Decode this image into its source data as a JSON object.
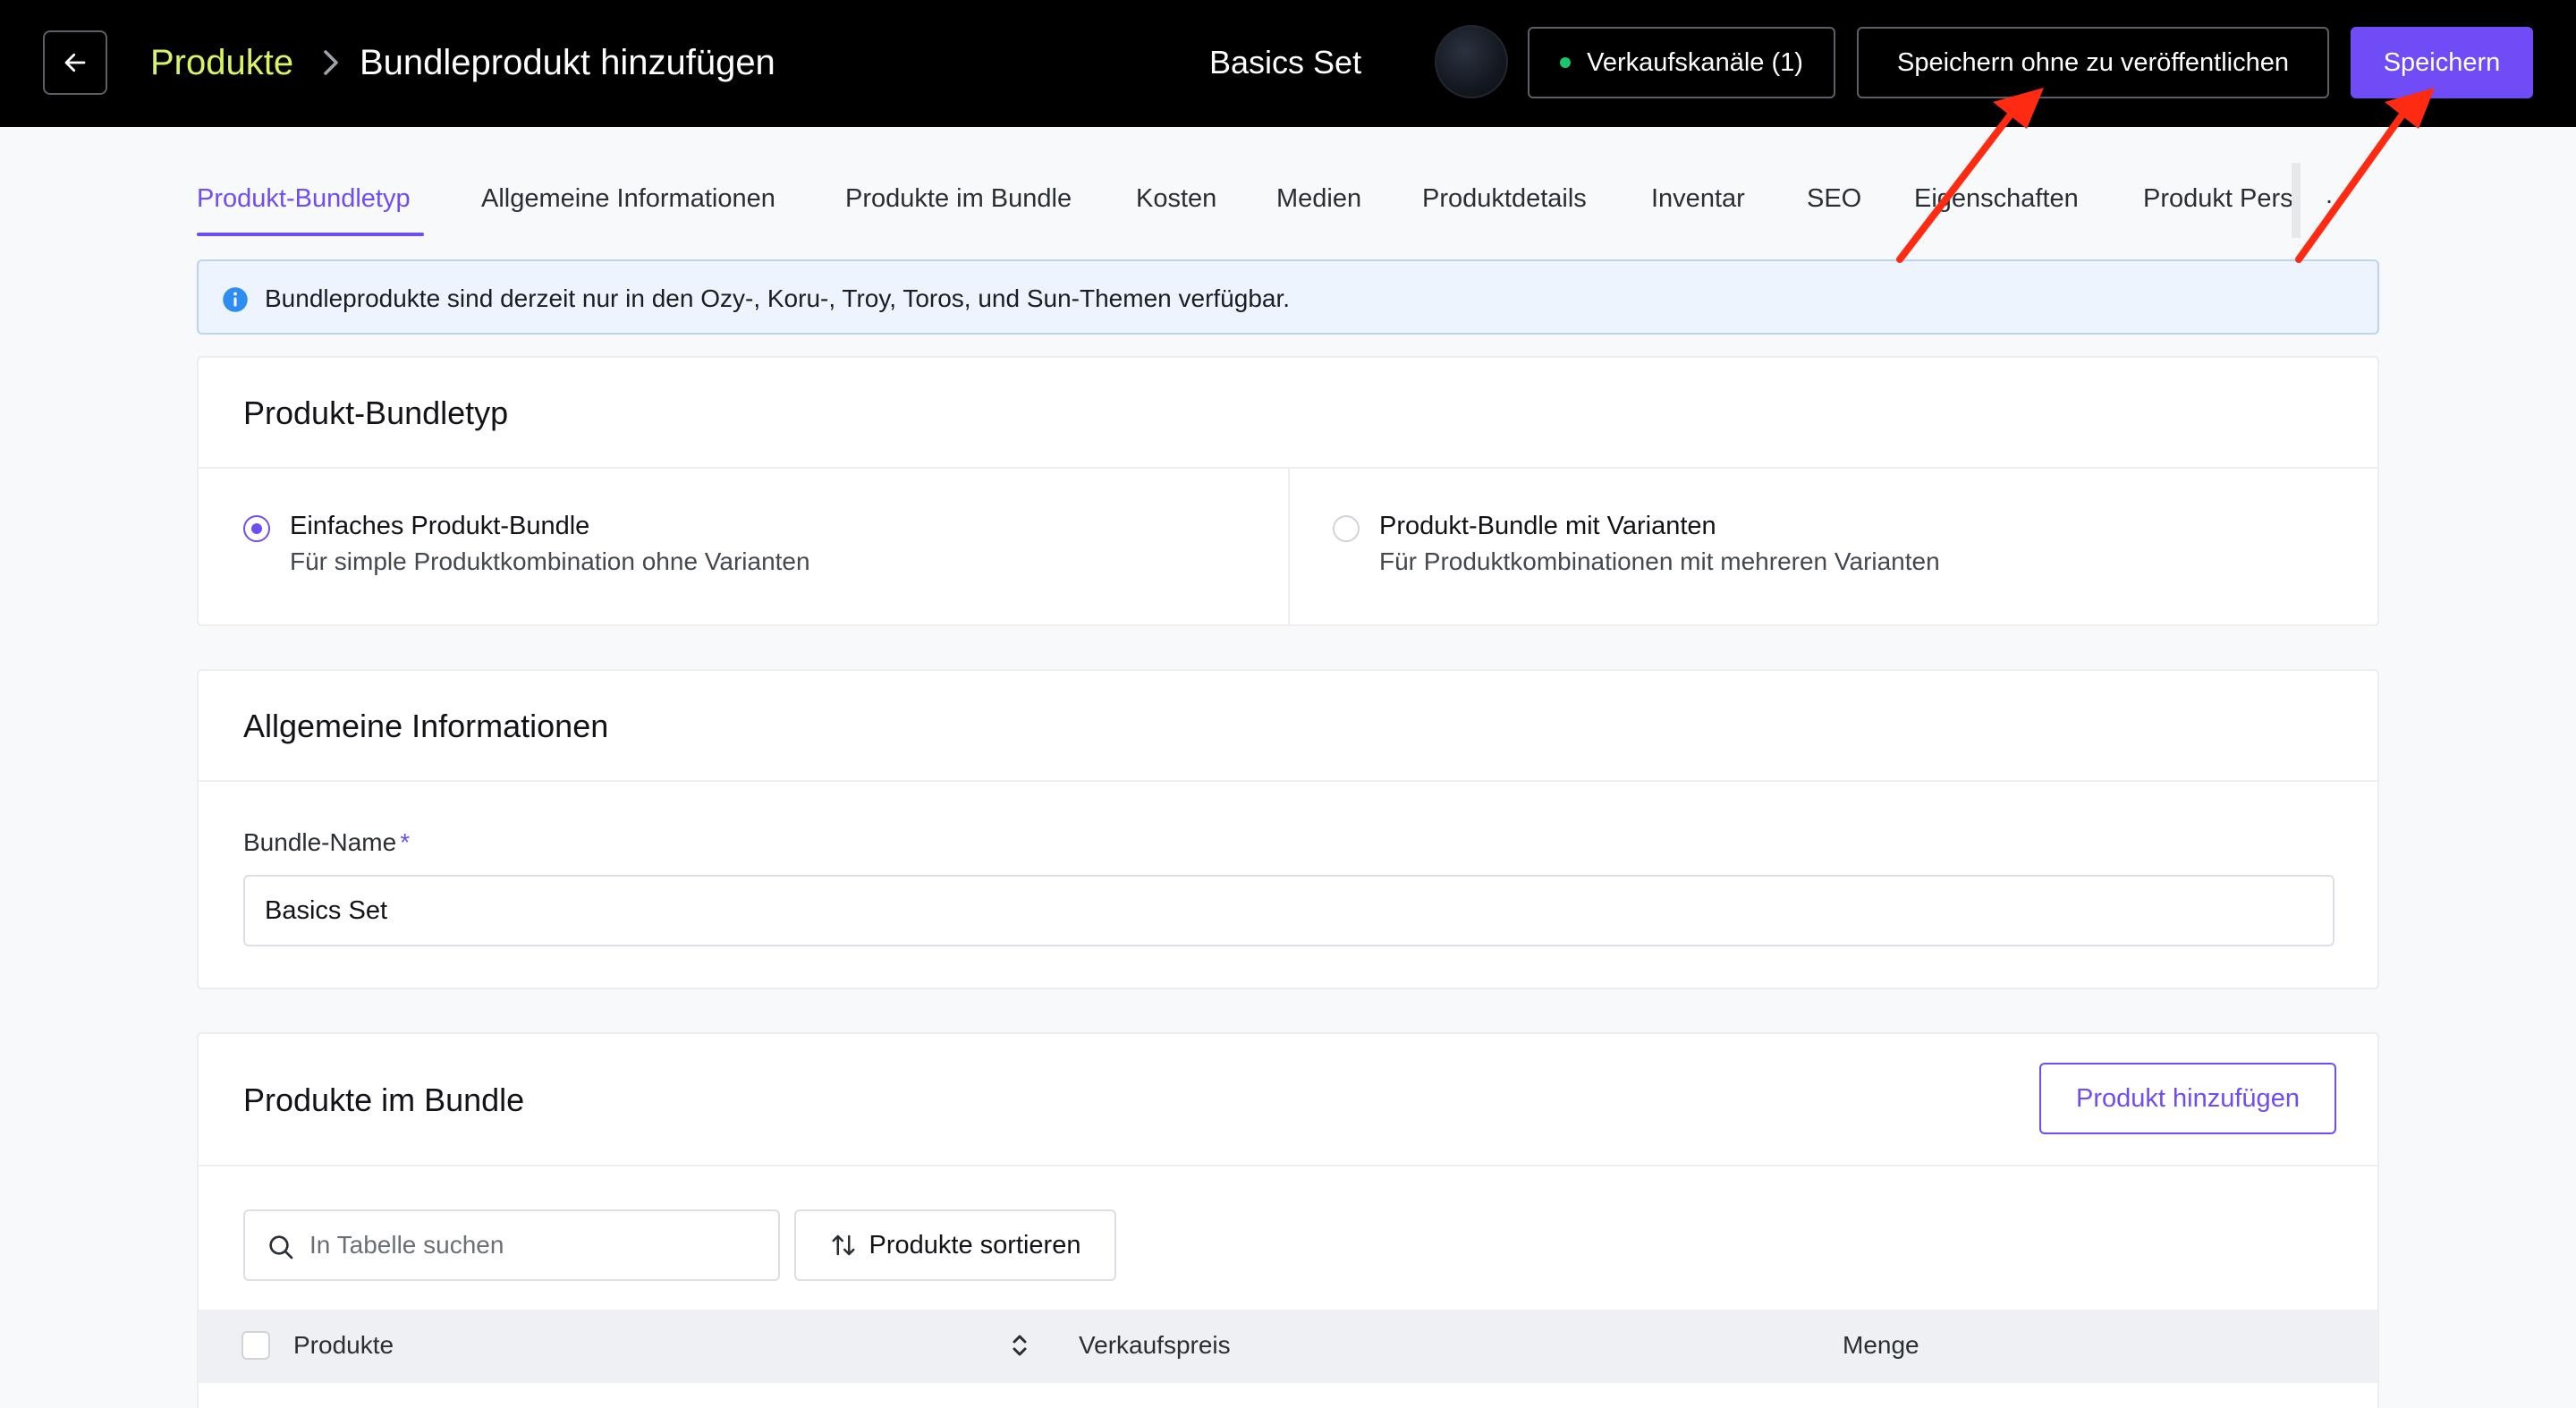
{
  "header": {
    "breadcrumb_root": "Produkte",
    "page_title": "Bundleprodukt hinzufügen",
    "product_name": "Basics Set",
    "channels_label": "Verkaufskanäle (1)",
    "save_draft_label": "Speichern ohne zu veröffentlichen",
    "save_label": "Speichern"
  },
  "tabs": [
    "Produkt-Bundletyp",
    "Allgemeine Informationen",
    "Produkte im Bundle",
    "Kosten",
    "Medien",
    "Produktdetails",
    "Inventar",
    "SEO",
    "Eigenschaften",
    "Produkt Pers"
  ],
  "active_tab": "Produkt-Bundletyp",
  "banner": {
    "text": "Bundleprodukte sind derzeit nur in den Ozy-, Koru-, Troy, Toros, und Sun-Themen verfügbar."
  },
  "bundle_type": {
    "title": "Produkt-Bundletyp",
    "options": [
      {
        "title": "Einfaches Produkt-Bundle",
        "description": "Für simple Produktkombination ohne Varianten",
        "selected": true
      },
      {
        "title": "Produkt-Bundle mit Varianten",
        "description": "Für Produktkombinationen mit mehreren Varianten",
        "selected": false
      }
    ]
  },
  "general": {
    "title": "Allgemeine Informationen",
    "name_label": "Bundle-Name",
    "required_mark": "*",
    "name_value": "Basics Set"
  },
  "products": {
    "title": "Produkte im Bundle",
    "add_label": "Produkt hinzufügen",
    "search_placeholder": "In Tabelle suchen",
    "sort_label": "Produkte sortieren",
    "columns": [
      "Produkte",
      "Verkaufspreis",
      "Menge"
    ]
  },
  "colors": {
    "accent": "#6f4cf6",
    "breadcrumb": "#d7f36a",
    "topbar": "#000000",
    "status_dot": "#1cc46b",
    "annotation": "#ff2a12"
  }
}
